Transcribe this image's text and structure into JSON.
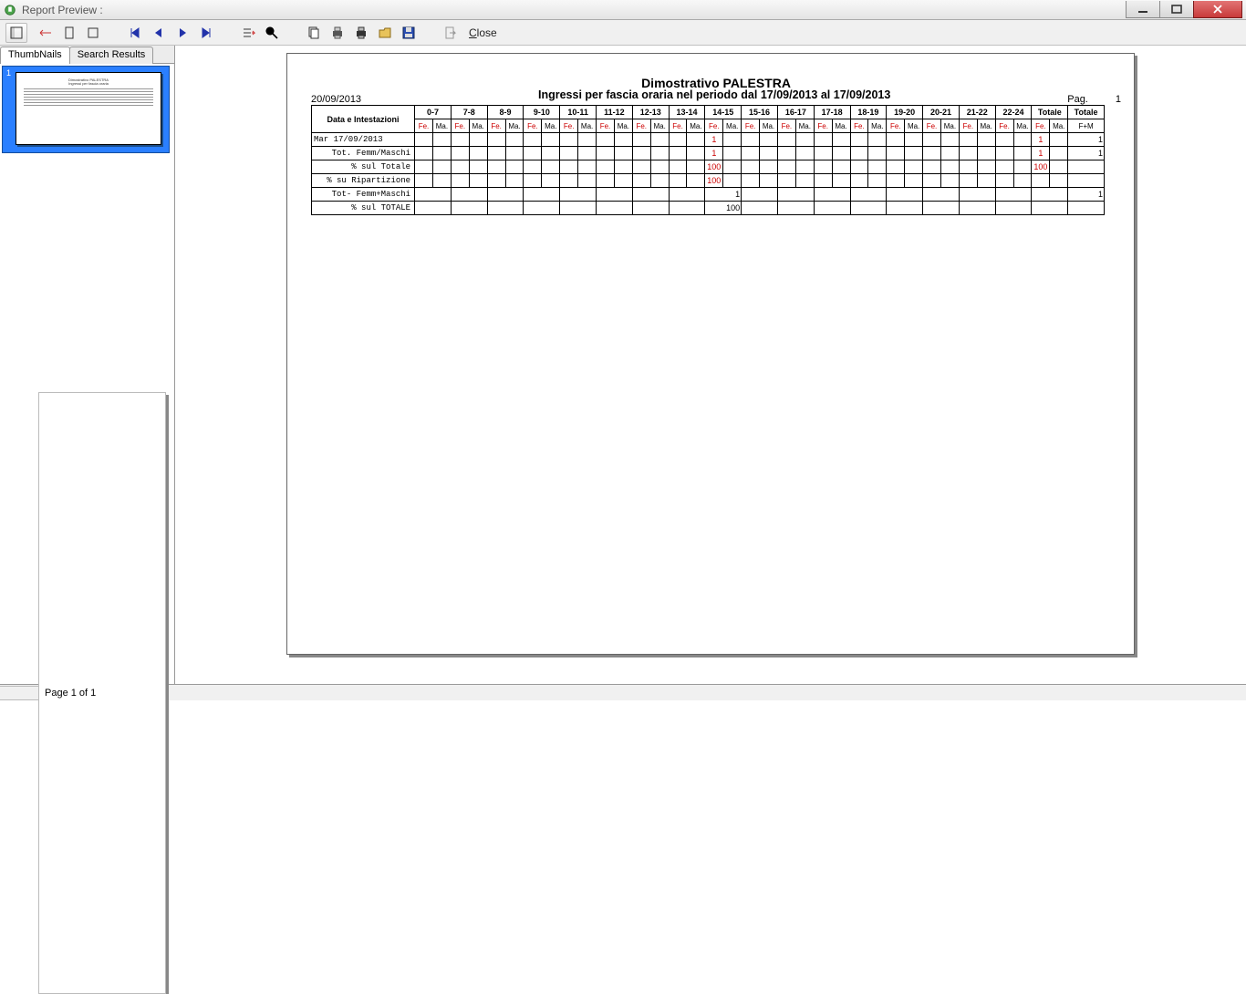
{
  "window": {
    "title": "Report Preview :"
  },
  "toolbar": {
    "close_label": "Close"
  },
  "sidebar": {
    "tabs": [
      {
        "label": "ThumbNails"
      },
      {
        "label": "Search Results"
      }
    ],
    "thumb_index": "1"
  },
  "statusbar": {
    "page_label": "Page 1 of 1"
  },
  "report": {
    "title": "Dimostrativo PALESTRA",
    "subtitle": "Ingressi per fascia oraria nel periodo dal 17/09/2013 al 17/09/2013",
    "print_date": "20/09/2013",
    "page_label": "Pag.",
    "page_num": "1",
    "header": {
      "label_col": "Data e Intestazioni",
      "time_slots": [
        "0-7",
        "7-8",
        "8-9",
        "9-10",
        "10-11",
        "11-12",
        "12-13",
        "13-14",
        "14-15",
        "15-16",
        "16-17",
        "17-18",
        "18-19",
        "19-20",
        "20-21",
        "21-22",
        "22-24"
      ],
      "fe": "Fe.",
      "ma": "Ma.",
      "totale": "Totale",
      "totale_fm": "Totale",
      "fm": "F+M"
    },
    "rows": [
      {
        "label": "Mar 17/09/2013",
        "align": "left",
        "cells": {
          "s8_fe": "1",
          "tot_fe": "1",
          "fm": "1"
        },
        "redCols": [
          "s8_fe",
          "tot_fe"
        ]
      },
      {
        "label": "Tot. Femm/Maschi",
        "cells": {
          "s8_fe": "1",
          "tot_fe": "1",
          "fm": "1"
        },
        "redCols": [
          "s8_fe",
          "tot_fe"
        ]
      },
      {
        "label": "% sul Totale",
        "cells": {
          "s8_fe": "100",
          "tot_fe": "100"
        },
        "redCols": [
          "s8_fe",
          "tot_fe"
        ]
      },
      {
        "label": "% su Ripartizione",
        "cells": {
          "s8_fe": "100"
        },
        "redCols": [
          "s8_fe"
        ]
      },
      {
        "label": "Tot- Femm+Maschi",
        "cells": {
          "s8_pair": "1",
          "fm": "1"
        }
      },
      {
        "label": "% sul TOTALE",
        "cells": {
          "s8_pair": "100"
        }
      }
    ]
  }
}
